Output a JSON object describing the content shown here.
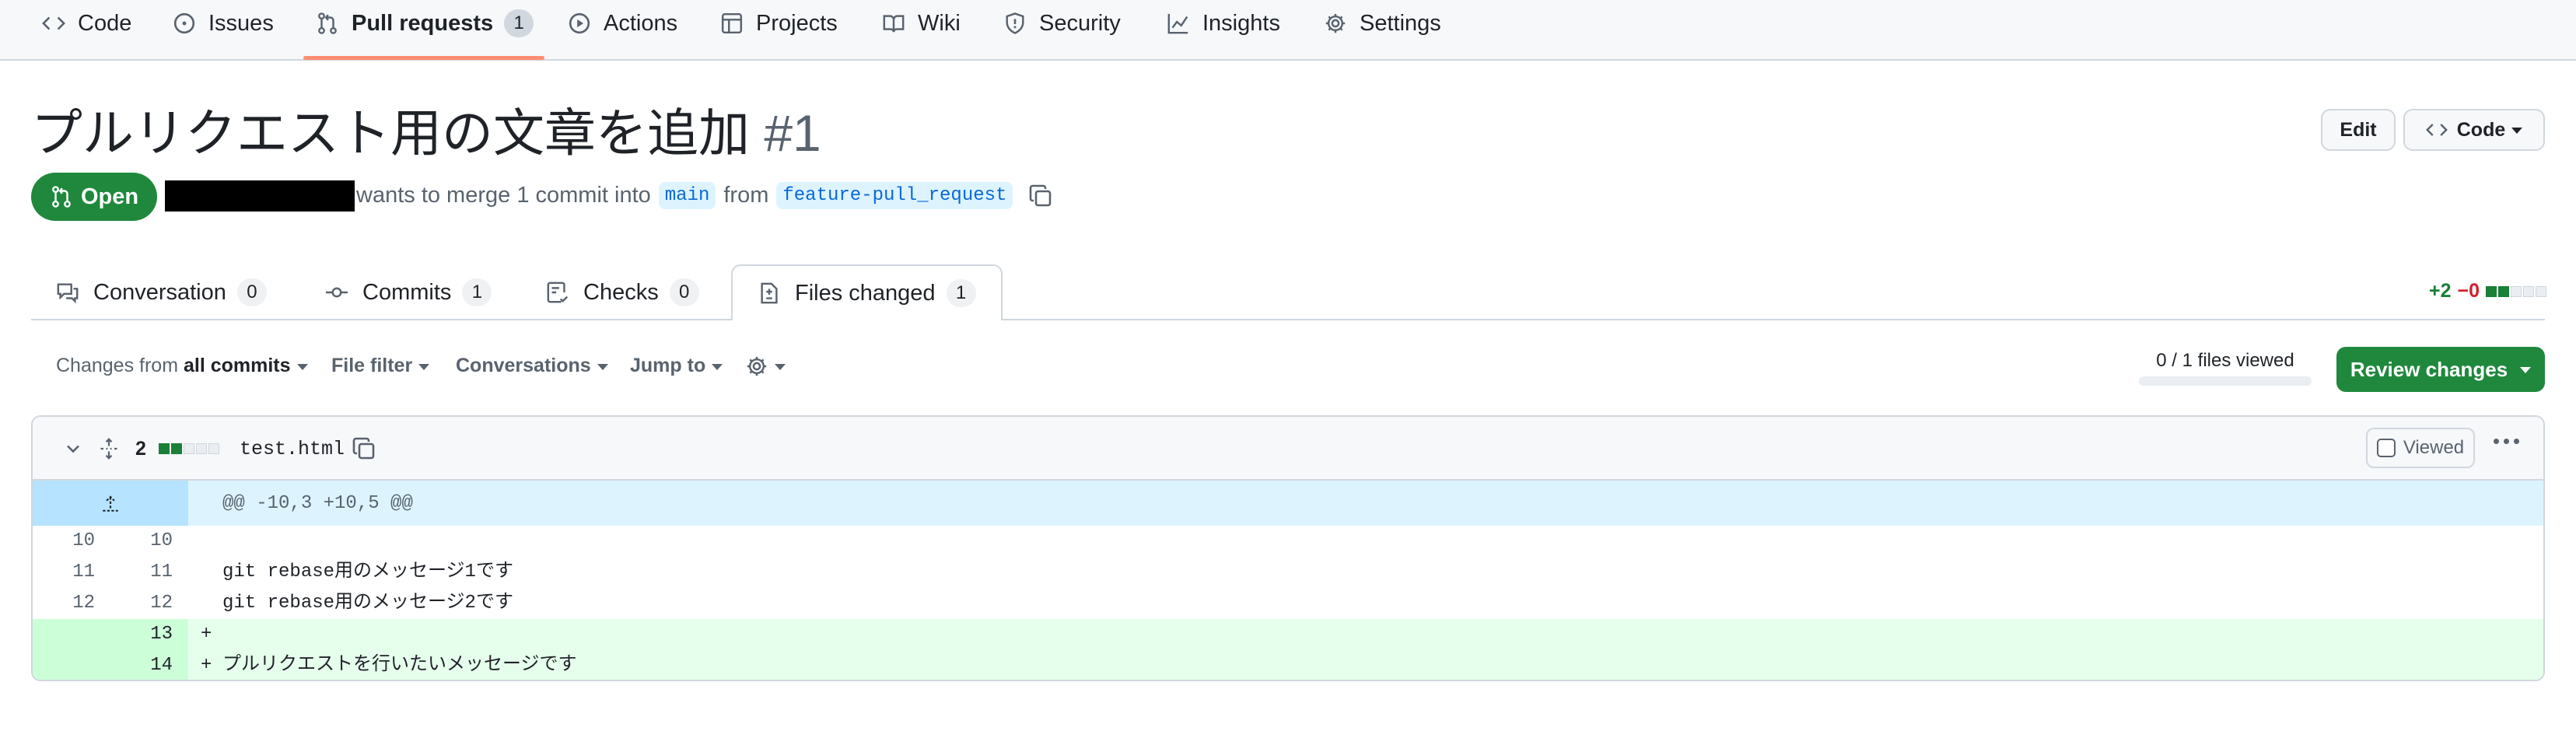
{
  "nav": {
    "items": [
      {
        "label": "Code",
        "icon": "code-icon"
      },
      {
        "label": "Issues",
        "icon": "issue-icon"
      },
      {
        "label": "Pull requests",
        "icon": "pull-request-icon",
        "count": "1",
        "active": true
      },
      {
        "label": "Actions",
        "icon": "play-icon"
      },
      {
        "label": "Projects",
        "icon": "table-icon"
      },
      {
        "label": "Wiki",
        "icon": "book-icon"
      },
      {
        "label": "Security",
        "icon": "shield-icon"
      },
      {
        "label": "Insights",
        "icon": "graph-icon"
      },
      {
        "label": "Settings",
        "icon": "gear-icon"
      }
    ]
  },
  "pr": {
    "title": "プルリクエスト用の文章を追加",
    "number": "#1",
    "edit_label": "Edit",
    "code_label": "Code",
    "state": "Open",
    "merge_text": "wants to merge 1 commit into",
    "base_branch": "main",
    "from_text": "from",
    "head_branch": "feature-pull_request"
  },
  "tabs": [
    {
      "label": "Conversation",
      "count": "0",
      "icon": "comment-icon"
    },
    {
      "label": "Commits",
      "count": "1",
      "icon": "commit-icon"
    },
    {
      "label": "Checks",
      "count": "0",
      "icon": "checklist-icon"
    },
    {
      "label": "Files changed",
      "count": "1",
      "icon": "file-diff-icon",
      "active": true
    }
  ],
  "diffstat": {
    "additions": "+2",
    "deletions": "−0",
    "green_blocks": 2,
    "total_blocks": 5
  },
  "toolbar": {
    "changes_prefix": "Changes from",
    "changes_value": "all commits",
    "file_filter": "File filter",
    "conversations": "Conversations",
    "jump_to": "Jump to",
    "files_viewed": "0 / 1 files viewed",
    "files_viewed_progress": 0,
    "review_changes": "Review changes"
  },
  "file": {
    "changes_count": "2",
    "name": "test.html",
    "viewed_label": "Viewed",
    "hunk_header": "@@ -10,3 +10,5 @@",
    "lines": [
      {
        "old": "10",
        "new": "10",
        "type": "context",
        "marker": "",
        "text": ""
      },
      {
        "old": "11",
        "new": "11",
        "type": "context",
        "marker": "",
        "text": "git rebase用のメッセージ1です"
      },
      {
        "old": "12",
        "new": "12",
        "type": "context",
        "marker": "",
        "text": "git rebase用のメッセージ2です"
      },
      {
        "old": "",
        "new": "13",
        "type": "added",
        "marker": "+",
        "text": ""
      },
      {
        "old": "",
        "new": "14",
        "type": "added",
        "marker": "+",
        "text": "プルリクエストを行いたいメッセージです"
      }
    ]
  },
  "colors": {
    "accent_green": "#1f883d",
    "nav_underline": "#fd8c73",
    "hunk_bg": "#ddf4ff",
    "added_bg": "#e6ffec"
  }
}
